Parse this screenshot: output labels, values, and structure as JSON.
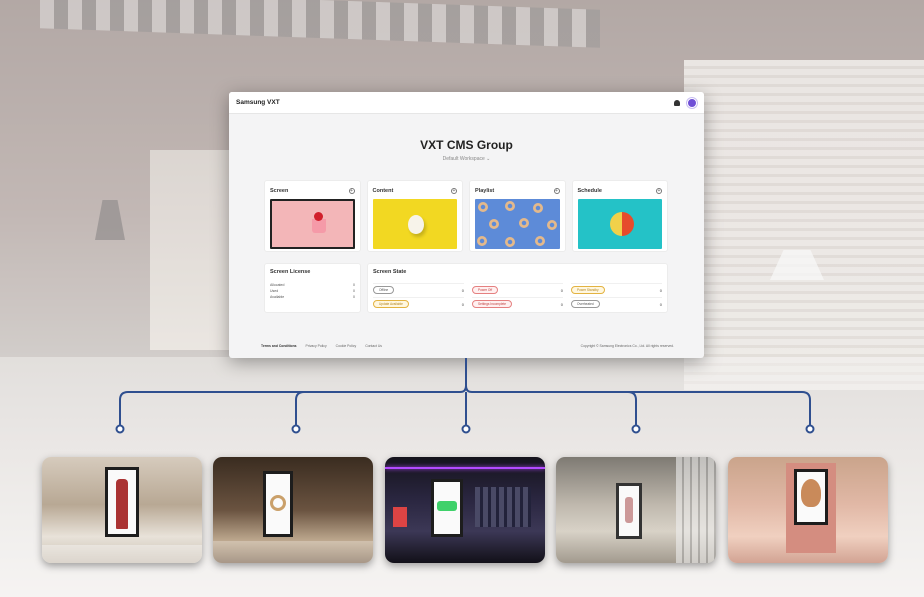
{
  "cms": {
    "brand": "Samsung VXT",
    "title": "VXT CMS Group",
    "workspace": "Default Workspace",
    "cards": [
      {
        "label": "Screen"
      },
      {
        "label": "Content"
      },
      {
        "label": "Playlist"
      },
      {
        "label": "Schedule"
      }
    ],
    "license": {
      "title": "Screen License",
      "rows": [
        {
          "label": "Allocated",
          "value": "0"
        },
        {
          "label": "Used",
          "value": "0"
        },
        {
          "label": "Available",
          "value": "0"
        }
      ]
    },
    "state": {
      "title": "Screen State",
      "items": [
        {
          "label": "Offline",
          "value": "0"
        },
        {
          "label": "Power Off",
          "value": "0"
        },
        {
          "label": "Power Standby",
          "value": "0"
        },
        {
          "label": "Update Available",
          "value": "0"
        },
        {
          "label": "Settings Incomplete",
          "value": "0"
        },
        {
          "label": "Overheated",
          "value": "0"
        }
      ]
    },
    "footer": {
      "links": [
        "Terms and Conditions",
        "Privacy Policy",
        "Cookie Policy",
        "Contact Us"
      ],
      "copyright": "Copyright © Samsung Electronics Co., Ltd. All rights reserved."
    }
  },
  "colors": {
    "connector": "#2f4f8f",
    "avatar": "#6f4fd6"
  },
  "photos": [
    {
      "icon": "retail-store-display-photo"
    },
    {
      "icon": "jewelry-store-display-photo"
    },
    {
      "icon": "sportswear-store-display-photo"
    },
    {
      "icon": "hotel-lobby-display-photo"
    },
    {
      "icon": "kids-mall-display-photo"
    }
  ]
}
